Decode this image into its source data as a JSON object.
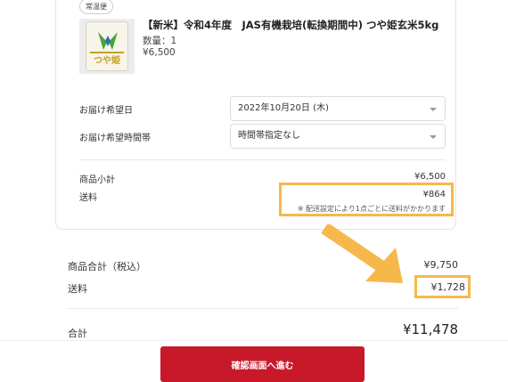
{
  "item": {
    "shipping_badge": "常温便",
    "title": "【新米】令和4年度　JAS有機栽培(転換期間中) つや姫玄米5kg",
    "quantity": "数量：1",
    "price": "¥6,500",
    "image_brand_text": "つや姫",
    "image_icon": "rice-bag-icon"
  },
  "delivery": {
    "date_label": "お届け希望日",
    "date_value": "2022年10月20日 (木)",
    "time_label": "お届け希望時間帯",
    "time_value": "時間帯指定なし"
  },
  "item_totals": {
    "subtotal_label": "商品小計",
    "subtotal_value": "¥6,500",
    "shipping_label": "送料",
    "shipping_value": "¥864",
    "shipping_note": "※ 配送設定により1点ごとに送料がかかります"
  },
  "order_summary": {
    "goods_total_label": "商品合計（税込）",
    "goods_total_value": "¥9,750",
    "shipping_label": "送料",
    "shipping_value": "¥1,728",
    "grand_total_label": "合計",
    "grand_total_value": "¥11,478"
  },
  "actions": {
    "confirm_label": "確認画面へ進む"
  },
  "colors": {
    "accent": "#c8192b",
    "highlight": "#f6b84b"
  }
}
